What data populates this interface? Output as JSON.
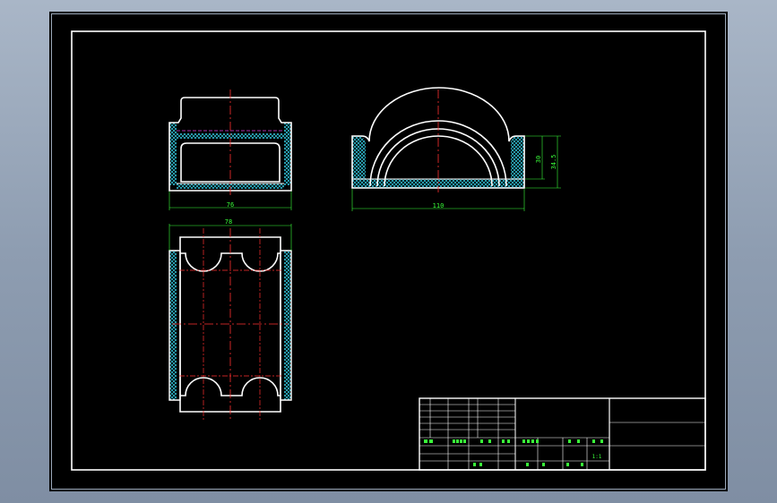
{
  "drawing": {
    "dimensions": {
      "side_view_width": "76",
      "top_view_width": "78",
      "front_view_length": "110",
      "front_view_height_inner": "30",
      "front_view_height_outer": "34.5"
    },
    "title_block": {
      "scale": "1:1"
    }
  },
  "colors": {
    "background": "#000000",
    "outline": "#ffffff",
    "center_line": "#ff3030",
    "dimension": "#39ff39",
    "hatch": "#35d0e6",
    "hidden_line": "#e040e0"
  }
}
